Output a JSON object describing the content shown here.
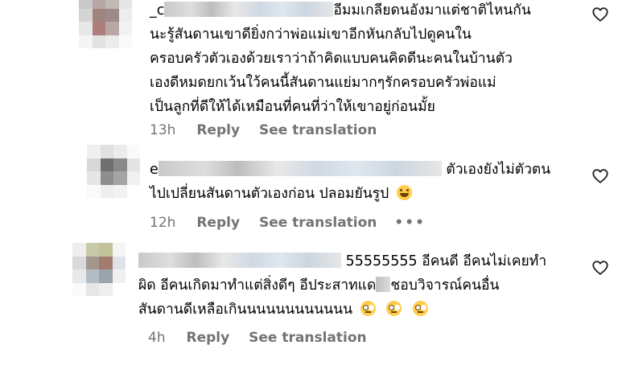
{
  "comments": [
    {
      "lines": [
        "อีมมเกลียดนอังมาแต่ชาติไหนกัน",
        "นะรู้สันดานเขาดียิ่งกว่าพ่อแม่เขาอีกหันกลับไปดูคนใน",
        "ครอบครัวตัวเองด้วยเราว่าถ้าคิดแบบคนคิดดีนะคนในบ้านตัว",
        "เองดีหมดยกเว้นใว้คนนี้สันดานแย่มากๆรักครอบครัวพ่อแม่",
        "เป็นลูกที่ดีให้ได้เหมือนที่คนที่ว่าให้เขาอยู่ก่อนมั้ย"
      ],
      "username_prefix": "_c",
      "time": "13h",
      "reply": "Reply",
      "translate": "See translation"
    },
    {
      "lines": [
        "ตัวเองยังไม่ตัวตน",
        "ไปเปลี่ยนสันดานตัวเองก่อน ปลอมยันรูป"
      ],
      "username_prefix": "e",
      "emoji": "face-with-tears-of-joy",
      "time": "12h",
      "reply": "Reply",
      "translate": "See translation",
      "more": "•••"
    },
    {
      "lines": [
        "55555555 อีคนดี อีคนไม่เคยทำ",
        "ผิด อีคนเกิดมาทำแต่สิ่งดีๆ อีประสาทแด",
        "ชอบวิจารณ์คนอื่น",
        "สันดานดีเหลือเกินนนนนนนนนนนน"
      ],
      "emoji": "face-with-rolling-eyes",
      "time": "4h",
      "reply": "Reply",
      "translate": "See translation"
    }
  ],
  "colors": {
    "meta_text": "#737373",
    "heart_stroke": "#262626",
    "body_text": "#000000"
  },
  "icons": {
    "like": "heart-outline-icon"
  }
}
